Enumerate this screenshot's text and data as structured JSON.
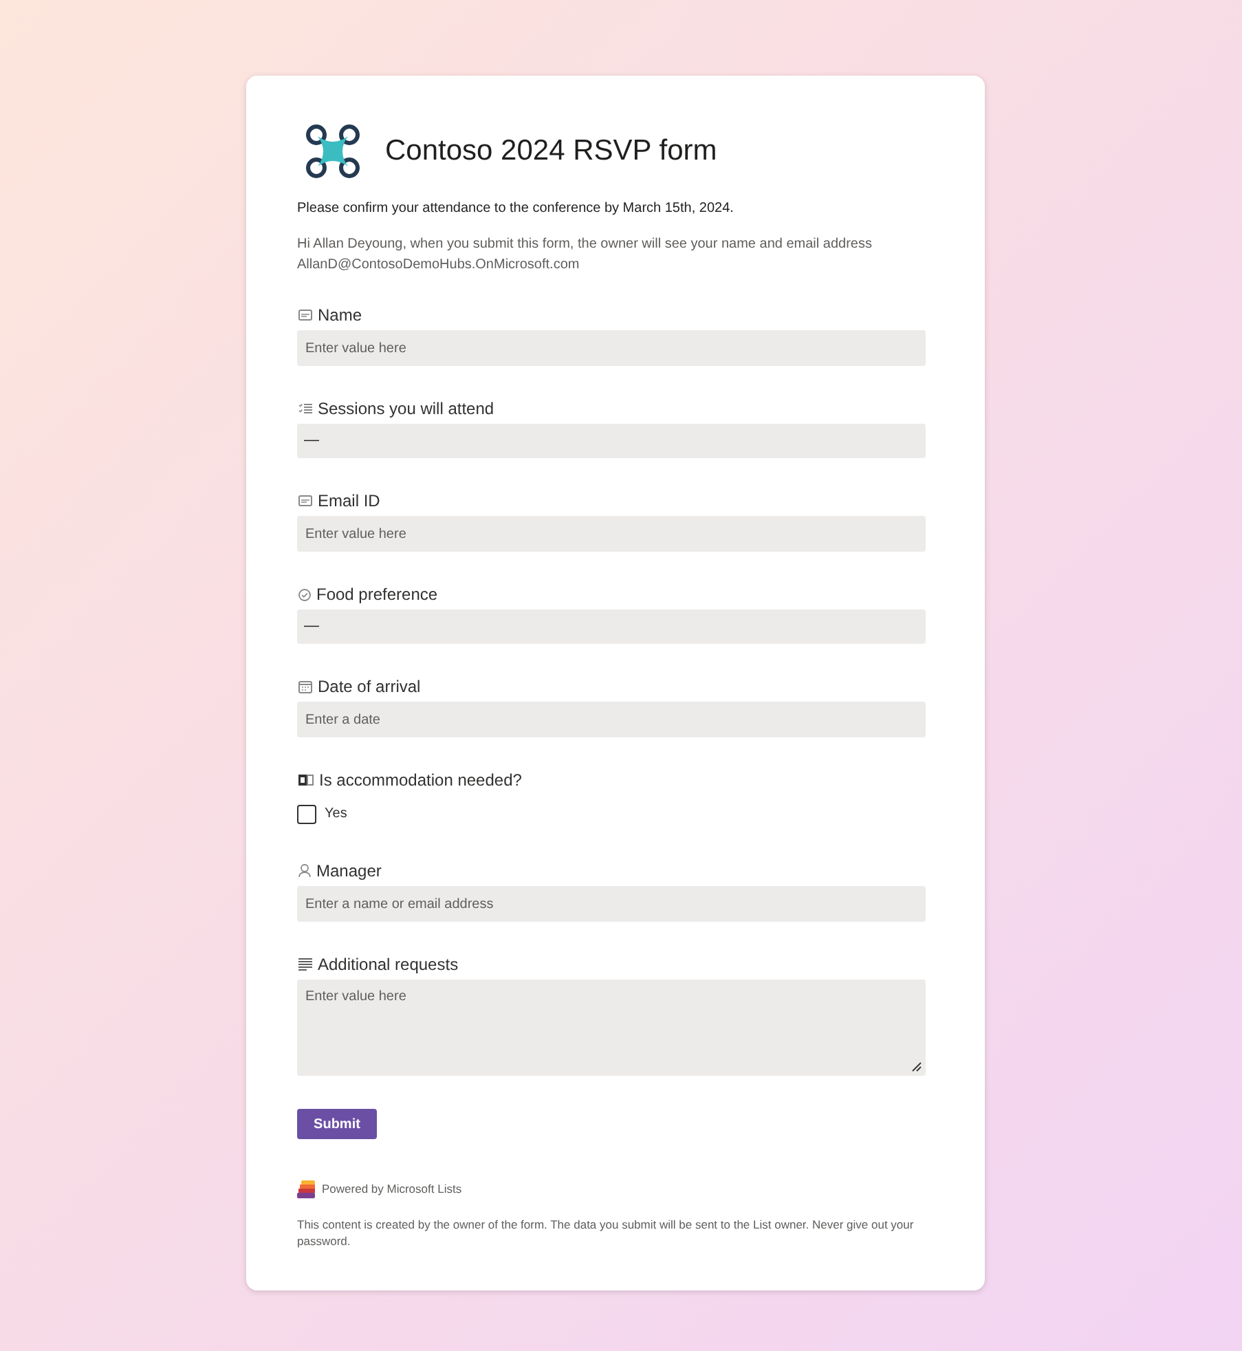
{
  "form": {
    "title": "Contoso 2024 RSVP form",
    "description": "Please confirm your attendance to the conference by March 15th, 2024.",
    "notice": "Hi Allan Deyoung, when you submit this form, the owner will see your name and email address AllanD@ContosoDemoHubs.OnMicrosoft.com"
  },
  "fields": [
    {
      "kind": "text",
      "label": "Name",
      "placeholder": "Enter value here"
    },
    {
      "kind": "multi_choice",
      "label": "Sessions you will attend",
      "value": "—"
    },
    {
      "kind": "text",
      "label": "Email ID",
      "placeholder": "Enter value here"
    },
    {
      "kind": "choice",
      "label": "Food preference",
      "value": "—"
    },
    {
      "kind": "date",
      "label": "Date of arrival",
      "placeholder": "Enter a date"
    },
    {
      "kind": "yes_no",
      "label": "Is accommodation needed?",
      "option": "Yes",
      "checked": false
    },
    {
      "kind": "person",
      "label": "Manager",
      "placeholder": "Enter a name or email address"
    },
    {
      "kind": "note",
      "label": "Additional requests",
      "placeholder": "Enter value here"
    }
  ],
  "submit_button": "Submit",
  "footer": {
    "powered_by": "Powered by Microsoft Lists",
    "disclaimer": "This content is created by the owner of the form. The data you submit will be sent to the List owner. Never give out your password."
  }
}
